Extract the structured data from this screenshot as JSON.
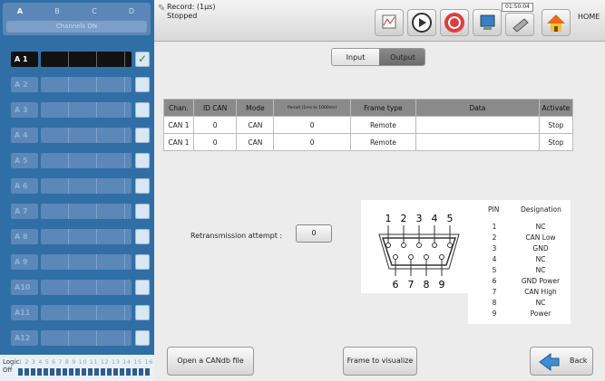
{
  "sidebar": {
    "tabs": [
      "A",
      "B",
      "C",
      "D"
    ],
    "channels_on": "Channels ON",
    "channels": [
      {
        "label": "A 1",
        "active": true,
        "checked": true
      },
      {
        "label": "A 2",
        "active": false,
        "checked": false
      },
      {
        "label": "A 3",
        "active": false,
        "checked": false
      },
      {
        "label": "A 4",
        "active": false,
        "checked": false
      },
      {
        "label": "A 5",
        "active": false,
        "checked": false
      },
      {
        "label": "A 6",
        "active": false,
        "checked": false
      },
      {
        "label": "A 7",
        "active": false,
        "checked": false
      },
      {
        "label": "A 8",
        "active": false,
        "checked": false
      },
      {
        "label": "A 9",
        "active": false,
        "checked": false
      },
      {
        "label": "A10",
        "active": false,
        "checked": false
      },
      {
        "label": "A11",
        "active": false,
        "checked": false
      },
      {
        "label": "A12",
        "active": false,
        "checked": false
      }
    ],
    "logic_label": "Logic",
    "logic_state": "Off",
    "logic_numbers": "1 2 3 4 5 6 7 8 9 10 11 12 13 14 15 16"
  },
  "topbar": {
    "record_label": "Record: (1µs)",
    "record_status": "Stopped",
    "clock": "01:50:04",
    "home_label": "HOME"
  },
  "main": {
    "input_tab": "Input",
    "output_tab": "Output",
    "table": {
      "headers": [
        "Chan.",
        "ID CAN",
        "Mode",
        "Period (1ms to 1000ms)",
        "Frame type",
        "Data",
        "Activate"
      ],
      "rows": [
        [
          "CAN 1",
          "0",
          "CAN",
          "0",
          "Remote",
          "",
          "Stop"
        ],
        [
          "CAN 1",
          "0",
          "CAN",
          "0",
          "Remote",
          "",
          "Stop"
        ]
      ]
    },
    "retransmission_label": "Retransmission attempt :",
    "retransmission_value": "0",
    "connector": {
      "top_pins": [
        "1",
        "2",
        "3",
        "4",
        "5"
      ],
      "bottom_pins": [
        "6",
        "7",
        "8",
        "9"
      ]
    },
    "pin_table": {
      "header_pin": "PIN",
      "header_designation": "Designation",
      "rows": [
        {
          "pin": "1",
          "designation": "NC"
        },
        {
          "pin": "2",
          "designation": "CAN Low"
        },
        {
          "pin": "3",
          "designation": "GND"
        },
        {
          "pin": "4",
          "designation": "NC"
        },
        {
          "pin": "5",
          "designation": "NC"
        },
        {
          "pin": "6",
          "designation": "GND Power"
        },
        {
          "pin": "7",
          "designation": "CAN High"
        },
        {
          "pin": "8",
          "designation": "NC"
        },
        {
          "pin": "9",
          "designation": "Power"
        }
      ]
    },
    "open_candb_button": "Open a CANdb file",
    "frame_visualize_button": "Frame to visualize",
    "back_button": "Back"
  }
}
